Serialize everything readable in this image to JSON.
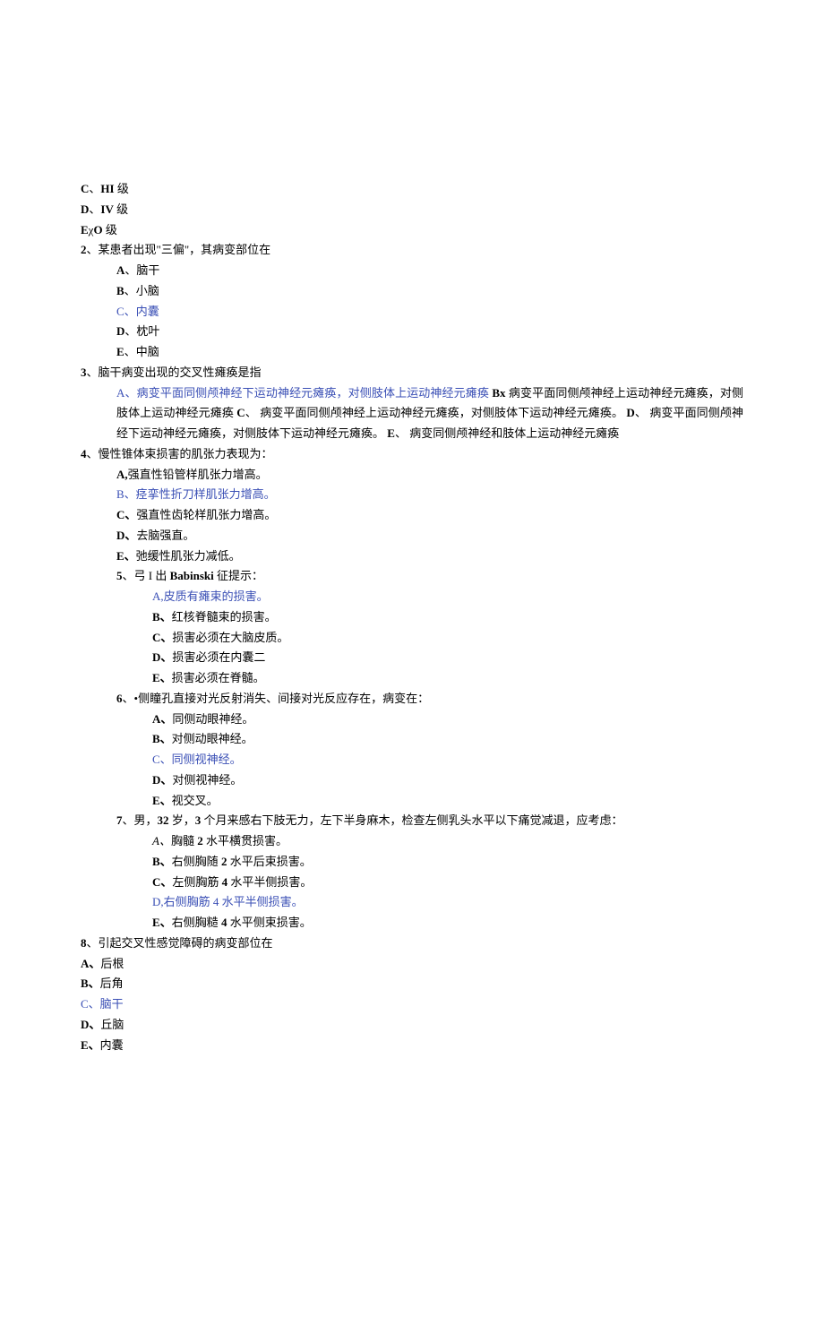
{
  "prefix_options": [
    {
      "label": "C、HI 级",
      "indent": "",
      "bold_parts": [
        "C",
        "HI"
      ]
    },
    {
      "label": "D、IV 级",
      "indent": "",
      "bold_parts": [
        "D",
        "IV"
      ]
    },
    {
      "label": "EχO 级",
      "indent": "",
      "bold_parts": [
        "E",
        "O"
      ]
    }
  ],
  "q2": {
    "stem_num": "2",
    "stem_text": "某患者出现\"三偏\"，其病变部位在",
    "options": [
      {
        "key": "A",
        "text": "脑干",
        "highlight": false
      },
      {
        "key": "B",
        "text": "小脑",
        "highlight": false
      },
      {
        "key": "C",
        "text": "内囊",
        "highlight": true
      },
      {
        "key": "D",
        "text": "枕叶",
        "highlight": false
      },
      {
        "key": "E",
        "text": "中脑",
        "highlight": false
      }
    ]
  },
  "q3": {
    "stem_num": "3",
    "stem_text": "脑干病变出现的交叉性瘫痪是指",
    "option_block": {
      "A": "病变平面同侧颅神经下运动神经元瘫痪，对侧肢体上运动神经元瘫痪",
      "B_label": "Bx",
      "B": "病变平面同侧颅神经上运动神经元瘫痪，对侧肢体上运动神经元瘫痪",
      "C": "病变平面同侧颅神经上运动神经元瘫痪，对侧肢体下运动神经元瘫痪。",
      "D": "病变平面同侧颅神经下运动神经元瘫痪，对侧肢体下运动神经元瘫痪。",
      "E": "病变同侧颅神经和肢体上运动神经元瘫痪"
    }
  },
  "q4": {
    "stem_num": "4",
    "stem_text": "慢性锥体束损害的肌张力表现为：",
    "options": [
      {
        "key": "A,",
        "text": "强直性铅管样肌张力增高。",
        "highlight": false
      },
      {
        "key": "B、",
        "text": "痉挛性折刀样肌张力增高。",
        "highlight": true
      },
      {
        "key": "C、",
        "text": "强直性齿轮样肌张力增高。",
        "highlight": false
      },
      {
        "key": "D、",
        "text": "去脑强直。",
        "highlight": false
      },
      {
        "key": "E、",
        "text": "弛缓性肌张力减低。",
        "highlight": false
      }
    ]
  },
  "q5": {
    "stem_num": "5",
    "stem_pre": "弓 I 出 ",
    "stem_babinski": "Babinski",
    "stem_post": " 征提示：",
    "options": [
      {
        "key": "A,",
        "text": "皮质有瘫束的损害。",
        "highlight": true
      },
      {
        "key": "B、",
        "text": "红核脊髓束的损害。",
        "highlight": false
      },
      {
        "key": "C、",
        "text": "损害必须在大脑皮质。",
        "highlight": false
      },
      {
        "key": "D、",
        "text": "损害必须在内囊二",
        "highlight": false
      },
      {
        "key": "E、",
        "text": "损害必须在脊髓。",
        "highlight": false
      }
    ]
  },
  "q6": {
    "stem_num": "6",
    "stem_text": "•侧瞳孔直接对光反射消失、间接对光反应存在，病变在：",
    "options": [
      {
        "key": "A、",
        "text": "同侧动眼神经。",
        "highlight": false
      },
      {
        "key": "B、",
        "text": "对侧动眼神经。",
        "highlight": false
      },
      {
        "key": "C、",
        "text": "同侧视神经。",
        "highlight": true
      },
      {
        "key": "D、",
        "text": "对侧视神经。",
        "highlight": false
      },
      {
        "key": "E、",
        "text": "视交叉。",
        "highlight": false
      }
    ]
  },
  "q7": {
    "stem_num": "7",
    "stem_age_num": "32",
    "stem_months_num": "3",
    "stem_text_1": "男，",
    "stem_text_2": " 岁，",
    "stem_text_3": " 个月来感右下肢无力，左下半身麻木，检查左侧乳头水平以下痛觉减退，应考虑：",
    "options": [
      {
        "key": "A、",
        "num": "2",
        "pre": "胸髓 ",
        "post": " 水平横贯损害。",
        "highlight": false,
        "italicA": true
      },
      {
        "key": "B、",
        "num": "2",
        "pre": "右侧胸随 ",
        "post": " 水平后束损害。",
        "highlight": false
      },
      {
        "key": "C、",
        "num": "4",
        "pre": "左侧胸筋 ",
        "post": " 水平半侧损害。",
        "highlight": false
      },
      {
        "key": "D,",
        "num": "4",
        "pre": "右侧胸筋 ",
        "post": " 水平半侧损害。",
        "highlight": true
      },
      {
        "key": "E、",
        "num": "4",
        "pre": "右侧胸糙 ",
        "post": " 水平侧束损害。",
        "highlight": false
      }
    ]
  },
  "q8": {
    "stem_num": "8",
    "stem_text": "引起交叉性感觉障碍的病变部位在",
    "options": [
      {
        "key": "A、",
        "text": "后根",
        "highlight": false
      },
      {
        "key": "B、",
        "text": "后角",
        "highlight": false
      },
      {
        "key": "C、",
        "text": "脑干",
        "highlight": true
      },
      {
        "key": "D、",
        "text": "丘脑",
        "highlight": false
      },
      {
        "key": "E、",
        "text": "内囊",
        "highlight": false
      }
    ]
  }
}
